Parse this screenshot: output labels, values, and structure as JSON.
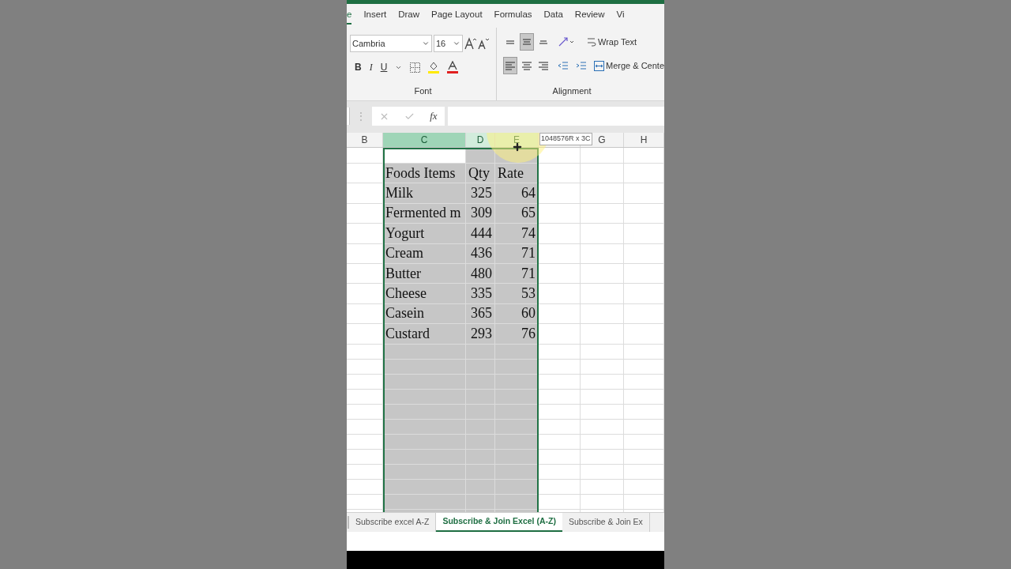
{
  "ribbon_tabs": [
    {
      "label": "e",
      "selected": true
    },
    {
      "label": "Insert",
      "selected": false
    },
    {
      "label": "Draw",
      "selected": false
    },
    {
      "label": "Page Layout",
      "selected": false
    },
    {
      "label": "Formulas",
      "selected": false
    },
    {
      "label": "Data",
      "selected": false
    },
    {
      "label": "Review",
      "selected": false
    },
    {
      "label": "Vi",
      "selected": false
    }
  ],
  "font_group": {
    "label": "Font",
    "font_name": "Cambria",
    "font_size": "16",
    "style_buttons": [
      "B",
      "I",
      "U"
    ]
  },
  "alignment_group": {
    "label": "Alignment",
    "vertical_align": [
      {
        "selected": false
      },
      {
        "selected": true
      },
      {
        "selected": false
      }
    ],
    "horizontal_align": [
      {
        "selected": true
      },
      {
        "selected": false
      },
      {
        "selected": false
      }
    ],
    "wrap_text": "Wrap Text",
    "merge_center": "Merge & Cente"
  },
  "formula_bar": {
    "separator": "⋮",
    "fx_label": "fx"
  },
  "columns": [
    {
      "label": "B",
      "selected": false,
      "active": false
    },
    {
      "label": "C",
      "selected": true,
      "active": true
    },
    {
      "label": "D",
      "selected": true,
      "active": false
    },
    {
      "label": "E",
      "selected": true,
      "active": false
    },
    {
      "selected": false,
      "active": false
    },
    {
      "label": "G",
      "selected": false,
      "active": false
    },
    {
      "label": "H",
      "selected": false,
      "active": false
    }
  ],
  "selection_tooltip": "1048576R x 3C",
  "rows": [
    [
      "",
      "",
      ""
    ],
    [
      "Foods Items",
      "Qty",
      "Rate"
    ],
    [
      "Milk",
      "325",
      "64"
    ],
    [
      "Fermented m",
      "309",
      "65"
    ],
    [
      "Yogurt",
      "444",
      "74"
    ],
    [
      "Cream",
      "436",
      "71"
    ],
    [
      "Butter",
      "480",
      "71"
    ],
    [
      "Cheese",
      "335",
      "53"
    ],
    [
      "Casein",
      "365",
      "60"
    ],
    [
      "Custard",
      "293",
      "76"
    ]
  ],
  "sheet_tabs": [
    {
      "label": "Subscribe excel A-Z",
      "selected": false
    },
    {
      "label": "Subscribe & Join Excel (A-Z)",
      "selected": true
    },
    {
      "label": "Subscribe & Join Ex",
      "selected": false
    }
  ]
}
